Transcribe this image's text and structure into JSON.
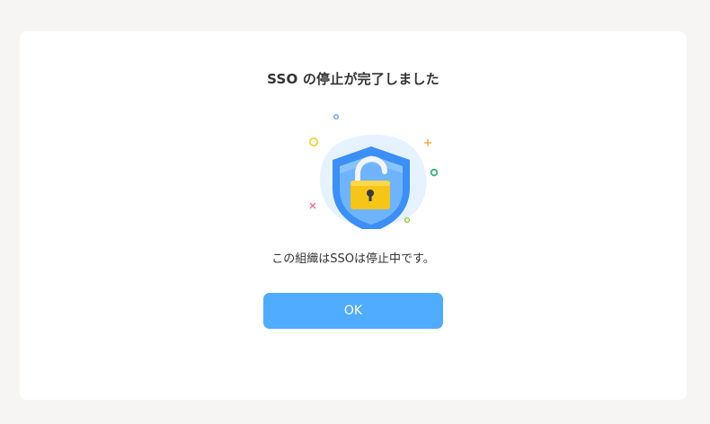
{
  "dialog": {
    "title": "SSO の停止が完了しました",
    "message": "この組織はSSOは停止中です。",
    "ok_label": "OK",
    "illustration_icon": "shield-unlocked-padlock-icon"
  },
  "colors": {
    "background": "#f6f5f3",
    "card": "#ffffff",
    "button": "#4facfe",
    "shield": "#3b8ff5",
    "padlock": "#f5c518"
  }
}
